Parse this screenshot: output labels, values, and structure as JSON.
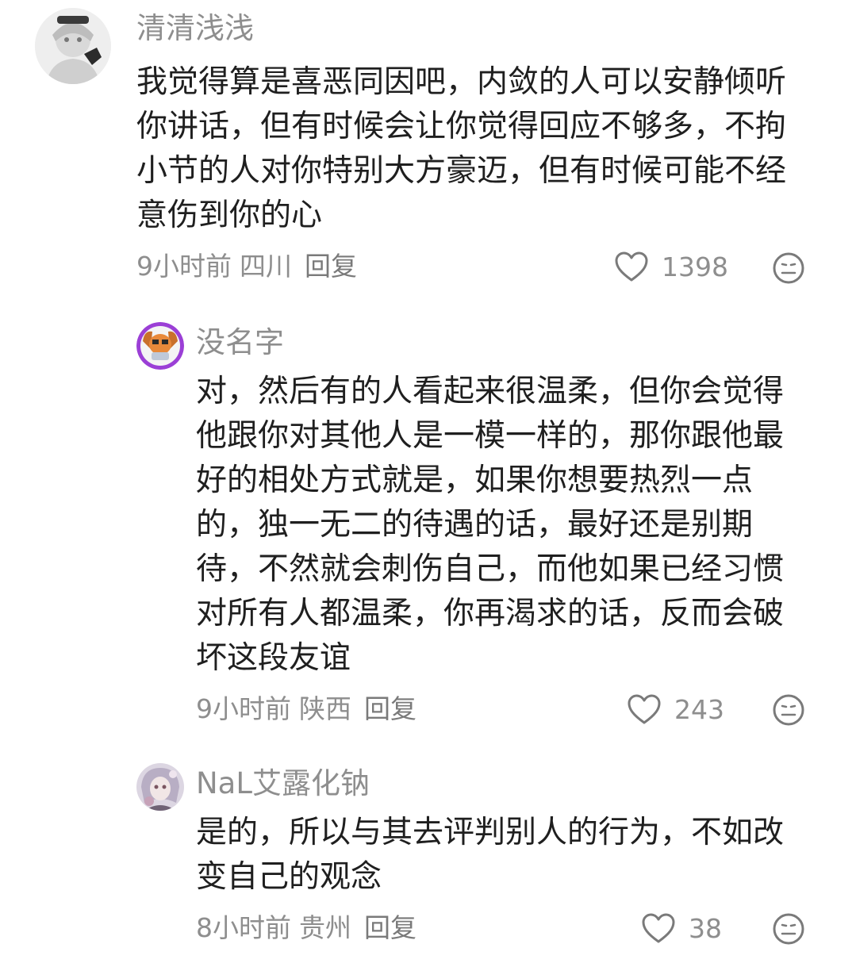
{
  "comments": [
    {
      "username": "清清浅浅",
      "text": "我觉得算是喜恶同因吧，内敛的人可以安静倾听你讲话，但有时候会让你觉得回应不够多，不拘小节的人对你特别大方豪迈，但有时候可能不经意伤到你的心",
      "time": "9小时前",
      "location": "四川",
      "reply_label": "回复",
      "likes": "1398"
    },
    {
      "username": "没名字",
      "text": "对，然后有的人看起来很温柔，但你会觉得他跟你对其他人是一模一样的，那你跟他最好的相处方式就是，如果你想要热烈一点的，独一无二的待遇的话，最好还是别期待，不然就会刺伤自己，而他如果已经习惯对所有人都温柔，你再渴求的话，反而会破坏这段友谊",
      "time": "9小时前",
      "location": "陕西",
      "reply_label": "回复",
      "likes": "243"
    },
    {
      "username": "NaL艾露化钠",
      "text": "是的，所以与其去评判别人的行为，不如改变自己的观念",
      "time": "8小时前",
      "location": "贵州",
      "reply_label": "回复",
      "likes": "38"
    }
  ],
  "icons": {
    "like": "heart-outline-icon",
    "dislike": "meh-face-icon"
  },
  "colors": {
    "text": "#1f1f1f",
    "meta": "#8e8e8e",
    "avatar2_ring": "#9b3fd6",
    "avatar2_face": "#e8893a"
  }
}
